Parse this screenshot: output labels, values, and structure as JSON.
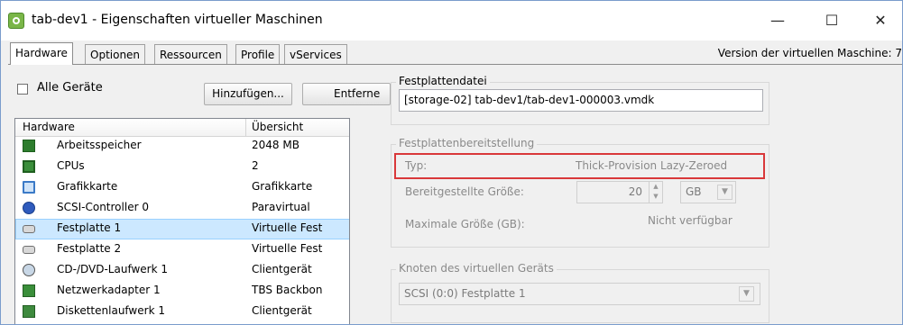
{
  "window": {
    "title": "tab-dev1 - Eigenschaften virtueller Maschinen",
    "minimize": "—",
    "maximize": "☐",
    "close": "✕"
  },
  "tabs": [
    "Hardware",
    "Optionen",
    "Ressourcen",
    "Profile",
    "vServices"
  ],
  "version_text": "Version der virtuellen Maschine: 7",
  "left": {
    "all_devices_label": "Alle Geräte",
    "add_button": "Hinzufügen...",
    "remove_button": "Entferne",
    "columns": [
      "Hardware",
      "Übersicht"
    ],
    "rows": [
      {
        "name": "Arbeitsspeicher",
        "value": "2048 MB",
        "icon": "memory-icon"
      },
      {
        "name": "CPUs",
        "value": "2",
        "icon": "cpu-icon"
      },
      {
        "name": "Grafikkarte",
        "value": "Grafikkarte",
        "icon": "video-card-icon"
      },
      {
        "name": "SCSI-Controller 0",
        "value": "Paravirtual",
        "icon": "scsi-controller-icon"
      },
      {
        "name": "Festplatte 1",
        "value": "Virtuelle Fest",
        "icon": "hard-disk-icon",
        "selected": true
      },
      {
        "name": "Festplatte 2",
        "value": "Virtuelle Fest",
        "icon": "hard-disk-icon"
      },
      {
        "name": "CD-/DVD-Laufwerk 1",
        "value": "Clientgerät",
        "icon": "cd-dvd-icon"
      },
      {
        "name": "Netzwerkadapter 1",
        "value": "TBS Backbon",
        "icon": "network-adapter-icon"
      },
      {
        "name": "Diskettenlaufwerk 1",
        "value": "Clientgerät",
        "icon": "floppy-icon"
      }
    ]
  },
  "right": {
    "disk_file_group": "Festplattendatei",
    "disk_file_value": "[storage-02] tab-dev1/tab-dev1-000003.vmdk",
    "provisioning_group": "Festplattenbereitstellung",
    "type_label": "Typ:",
    "type_value": "Thick-Provision Lazy-Zeroed",
    "provisioned_label": "Bereitgestellte Größe:",
    "provisioned_value": "20",
    "provisioned_unit": "GB",
    "max_label": "Maximale Größe (GB):",
    "max_value": "Nicht verfügbar",
    "node_group": "Knoten des virtuellen Geräts",
    "node_value": "SCSI (0:0) Festplatte 1"
  },
  "colors": {
    "highlight_box": "#d9383a",
    "selection": "#cce8ff"
  }
}
